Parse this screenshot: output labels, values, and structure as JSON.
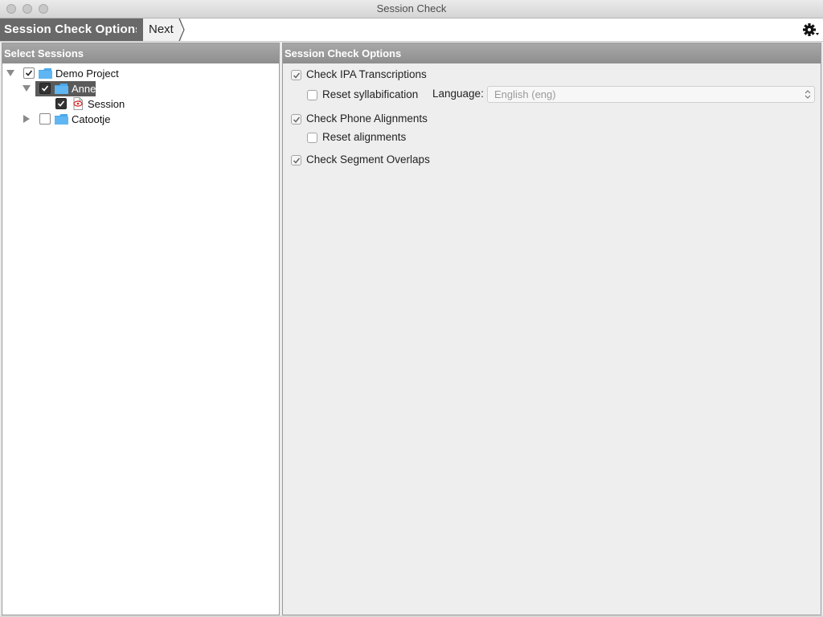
{
  "window": {
    "title": "Session Check"
  },
  "breadcrumb": {
    "current": "Session Check Options",
    "next": "Next"
  },
  "left_panel": {
    "title": "Select Sessions",
    "tree": [
      {
        "label": "Demo Project",
        "checked": true,
        "expanded": true,
        "type": "project"
      },
      {
        "label": "Anne",
        "checked": true,
        "expanded": true,
        "selected": true,
        "type": "corpus"
      },
      {
        "label": "Session",
        "checked": true,
        "type": "session"
      },
      {
        "label": "Catootje",
        "checked": false,
        "expanded": false,
        "type": "corpus"
      }
    ]
  },
  "right_panel": {
    "title": "Session Check Options",
    "check_ipa": {
      "label": "Check IPA Transcriptions",
      "checked": true
    },
    "reset_syllabification": {
      "label": "Reset syllabification",
      "checked": false
    },
    "language": {
      "label": "Language:",
      "value": "English (eng)"
    },
    "check_phone_alignments": {
      "label": "Check Phone Alignments",
      "checked": true
    },
    "reset_alignments": {
      "label": "Reset alignments",
      "checked": false
    },
    "check_segment_overlaps": {
      "label": "Check Segment Overlaps",
      "checked": true
    }
  },
  "icons": {
    "folder": "folder-icon",
    "session": "session-file-icon",
    "settings": "gear-icon"
  },
  "colors": {
    "folder": "#4aa8ec",
    "selection": "#5a5a5a",
    "header": "#969696"
  }
}
